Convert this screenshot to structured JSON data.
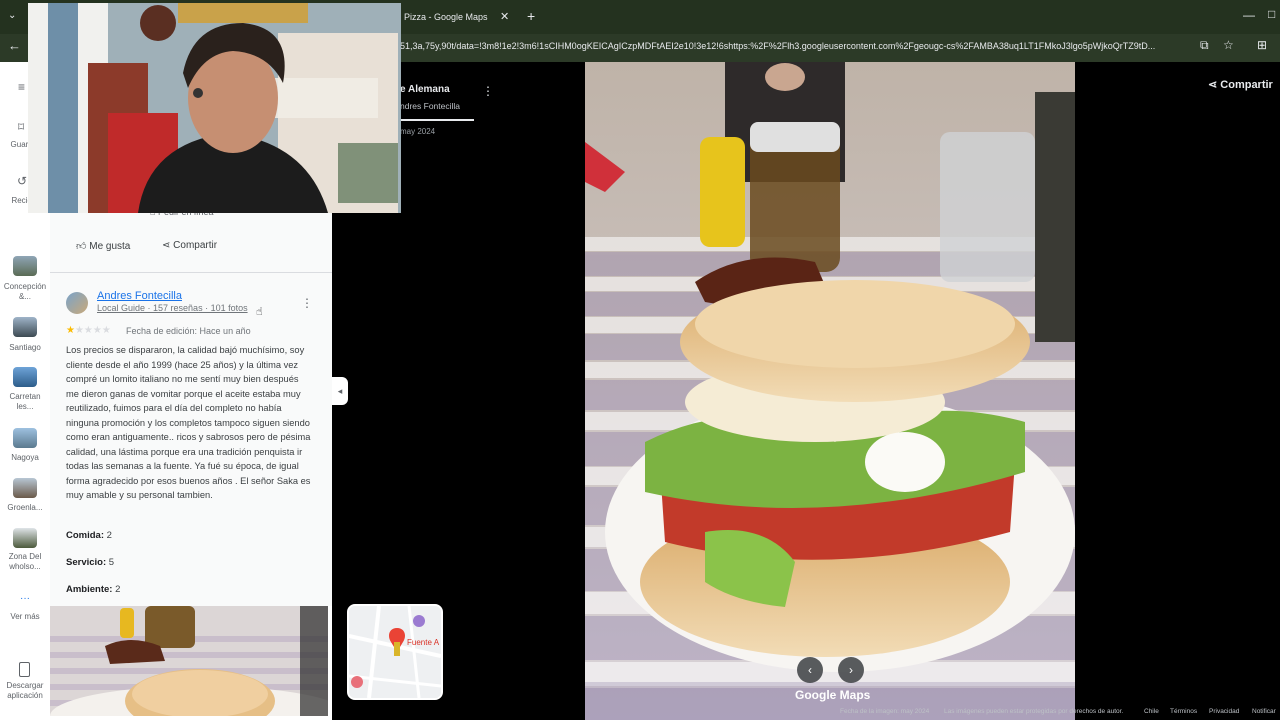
{
  "browser": {
    "tab_title": "Pizza - Google Maps",
    "tab_close": "✕",
    "new_tab": "+",
    "minimize": "—",
    "url": "51,3a,75y,90t/data=!3m8!1e2!3m6!1sCIHM0ogKEICAgICzpMDFtAEI2e10!3e12!6shttps:%2F%2Flh3.googleusercontent.com%2Fgeougc-cs%2FAMBA38uq1LT1FMkoJ3lgo5pWjkoQrTZ9tD..."
  },
  "rail": {
    "items": [
      {
        "label": "Guard..."
      },
      {
        "label": "Recie..."
      },
      {
        "label": "Concepción &..."
      },
      {
        "label": "Santiago"
      },
      {
        "label": "Carretan les..."
      },
      {
        "label": "Nagoya"
      },
      {
        "label": "Groenla..."
      },
      {
        "label": "Zona Del wholso..."
      },
      {
        "label": "Ver más"
      },
      {
        "label": "Descargar aplicación"
      }
    ],
    "ellipsis": "···"
  },
  "review": {
    "order_online": "Pedir en línea",
    "like": "Me gusta",
    "share": "Compartir",
    "author": "Andres Fontecilla",
    "author_meta": "Local Guide · 157 reseñas · 101 fotos",
    "rating_stars": 1,
    "edit_date": "Fecha de edición: Hace un año",
    "text": "Los precios se dispararon, la calidad bajó muchísimo, soy cliente desde el año 1999 (hace 25 años) y la última vez compré un lomito italiano no me sentí muy bien después me dieron ganas de vomitar porque el aceite estaba muy reutilizado, fuimos para el día del completo no había ninguna promoción y los completos tampoco siguen siendo como eran antiguamente.. ricos y sabrosos pero de pésima calidad, una lástima porque era una tradición penquista ir todas las semanas a la fuente. Ya fué su época, de igual forma agradecido por esos buenos años . El señor Saka es muy amable y su personal tambien.",
    "food_label": "Comida:",
    "food_value": "2",
    "service_label": "Servicio:",
    "service_value": "5",
    "ambience_label": "Ambiente:",
    "ambience_value": "2"
  },
  "place": {
    "title": "e Alemana",
    "subtitle": "ndres Fontecilla",
    "date": "may 2024",
    "map_label": "Fuente A"
  },
  "photo": {
    "share": "Compartir",
    "logo": "Google Maps",
    "prev": "‹",
    "next": "›"
  },
  "footer": {
    "image_date": "Fecha de la imagen: may 2024",
    "copyright": "Las imágenes pueden estar protegidas por derechos de autor.",
    "country": "Chile",
    "terms": "Términos",
    "privacy": "Privacidad",
    "report": "Notificar"
  },
  "colors": {
    "link": "#1a73e8",
    "star": "#fbbc04",
    "chrome": "#24321f"
  }
}
